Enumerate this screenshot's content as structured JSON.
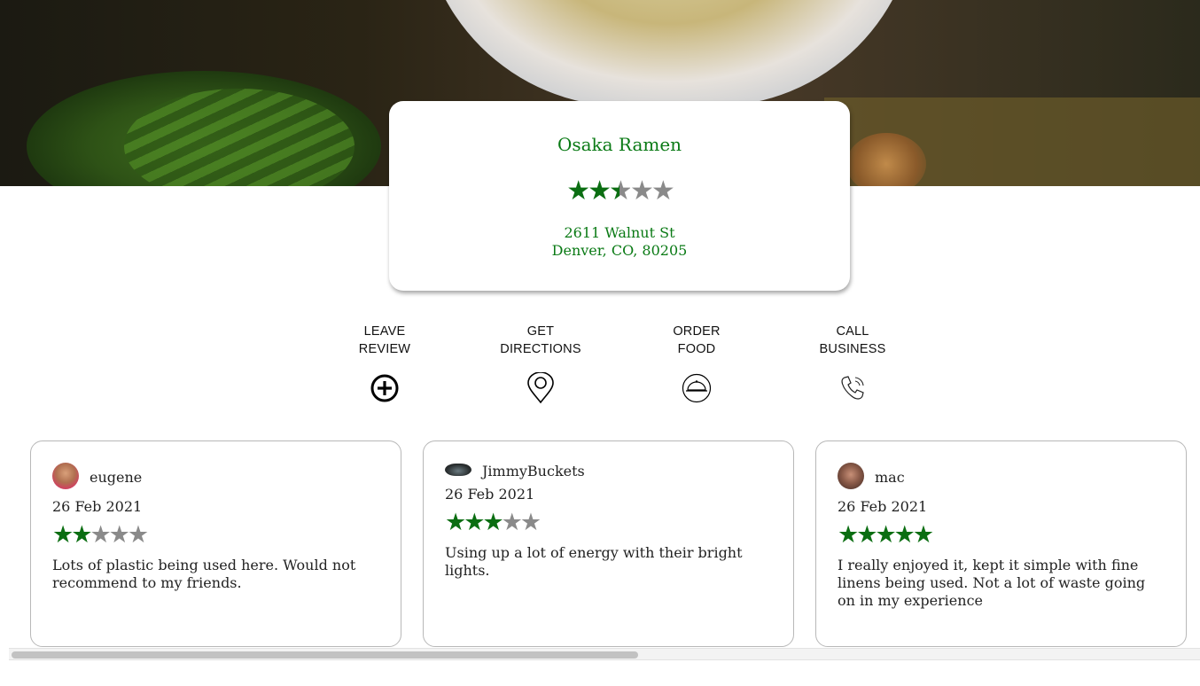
{
  "restaurant": {
    "name": "Osaka Ramen",
    "rating": 2.5,
    "address_line1": "2611 Walnut St",
    "address_line2": "Denver, CO, 80205"
  },
  "actions": [
    {
      "line1": "LEAVE",
      "line2": "REVIEW",
      "icon": "plus-circle-icon"
    },
    {
      "line1": "GET",
      "line2": "DIRECTIONS",
      "icon": "map-pin-icon"
    },
    {
      "line1": "ORDER",
      "line2": "FOOD",
      "icon": "food-cloche-icon"
    },
    {
      "line1": "CALL",
      "line2": "BUSINESS",
      "icon": "phone-icon"
    }
  ],
  "reviews": [
    {
      "user": "eugene",
      "date": "26 Feb 2021",
      "rating": 2,
      "text": "Lots of plastic being used here. Would not recommend to my friends."
    },
    {
      "user": "JimmyBuckets",
      "date": "26 Feb 2021",
      "rating": 3,
      "text": "Using up a lot of energy with their bright lights."
    },
    {
      "user": "mac",
      "date": "26 Feb 2021",
      "rating": 5,
      "text": "I really enjoyed it, kept it simple with fine linens being used. Not a lot of waste going on in my experience"
    }
  ],
  "colors": {
    "accent": "#0a7a15",
    "star_on": "#0b6e12",
    "star_off": "#8a8a8a"
  }
}
